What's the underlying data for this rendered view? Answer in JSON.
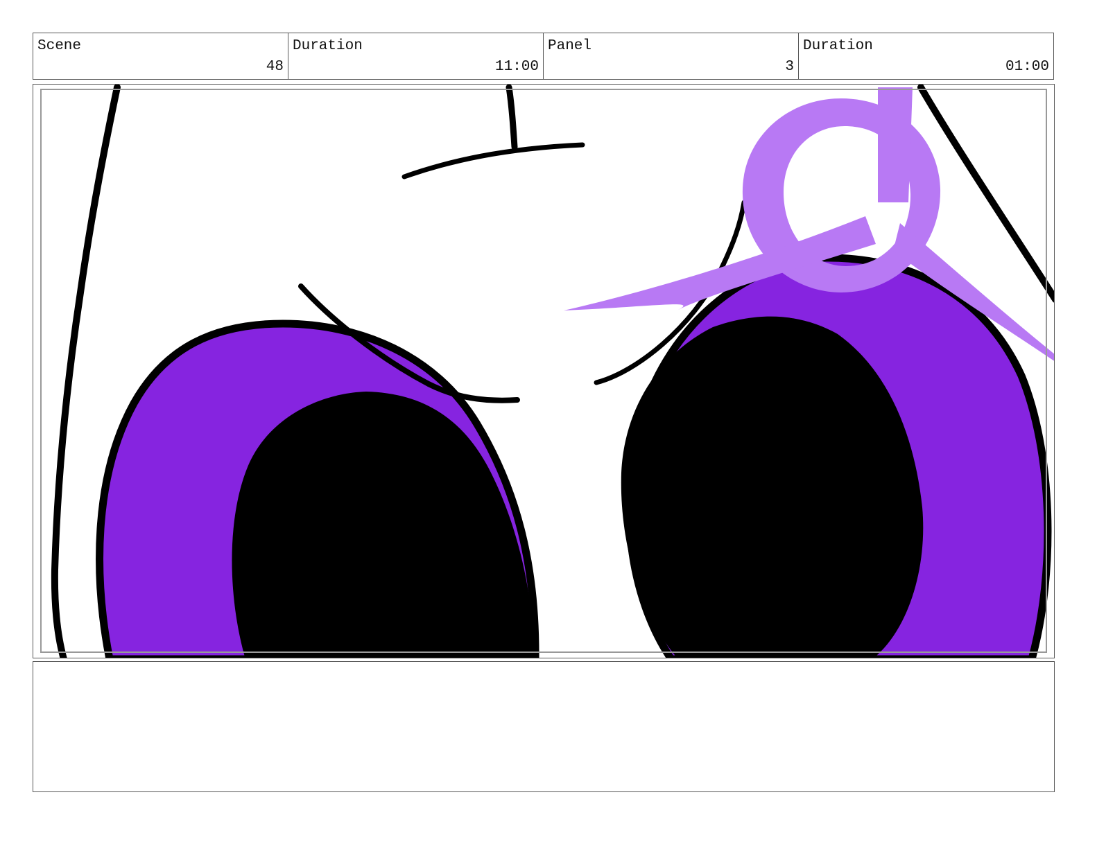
{
  "header": {
    "scene_label": "Scene",
    "scene_value": "48",
    "scene_duration_label": "Duration",
    "scene_duration_value": "11:00",
    "panel_label": "Panel",
    "panel_value": "3",
    "panel_duration_label": "Duration",
    "panel_duration_value": "01:00"
  },
  "frame": {
    "colors": {
      "line": "#000000",
      "iris": "#8624e0",
      "highlight": "#b879f4",
      "safe_area": "#999999"
    }
  },
  "notes": {
    "text": ""
  }
}
